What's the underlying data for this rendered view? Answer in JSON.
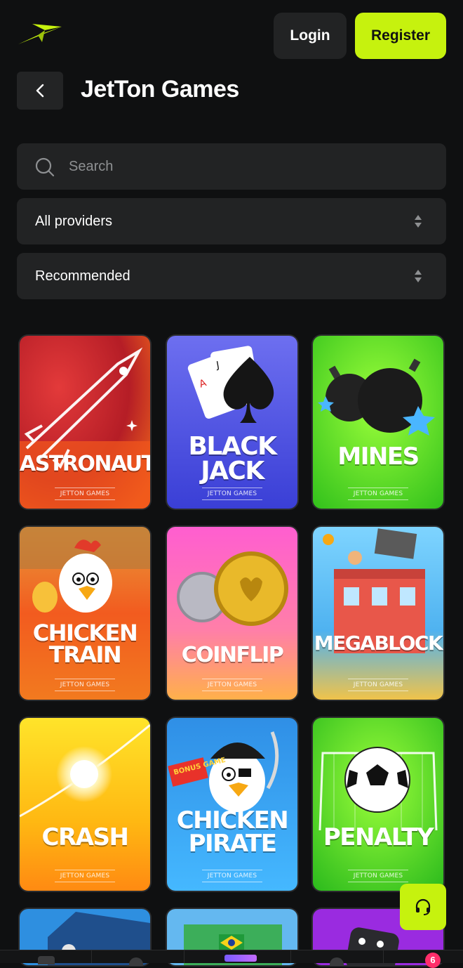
{
  "header": {
    "login_label": "Login",
    "register_label": "Register"
  },
  "page": {
    "title": "JetTon Games"
  },
  "search": {
    "placeholder": "Search"
  },
  "filters": {
    "provider": "All providers",
    "sort": "Recommended"
  },
  "brand_label": "JETTON GAMES",
  "games": [
    {
      "name_line1": "ASTRONAUT",
      "name_line2": ""
    },
    {
      "name_line1": "BLACK",
      "name_line2": "JACK"
    },
    {
      "name_line1": "MINES",
      "name_line2": ""
    },
    {
      "name_line1": "CHICKEN",
      "name_line2": "TRAIN"
    },
    {
      "name_line1": "COINFLIP",
      "name_line2": ""
    },
    {
      "name_line1": "MEGABLOCK",
      "name_line2": ""
    },
    {
      "name_line1": "CRASH",
      "name_line2": ""
    },
    {
      "name_line1": "CHICKEN",
      "name_line2": "PIRATE",
      "tag": "BONUS GAME"
    },
    {
      "name_line1": "PENALTY",
      "name_line2": ""
    }
  ],
  "bottom_nav": {
    "badge_count": "6"
  },
  "colors": {
    "accent": "#c6f20e",
    "background": "#0f1011",
    "surface": "#222324",
    "badge": "#ff2e6a"
  }
}
